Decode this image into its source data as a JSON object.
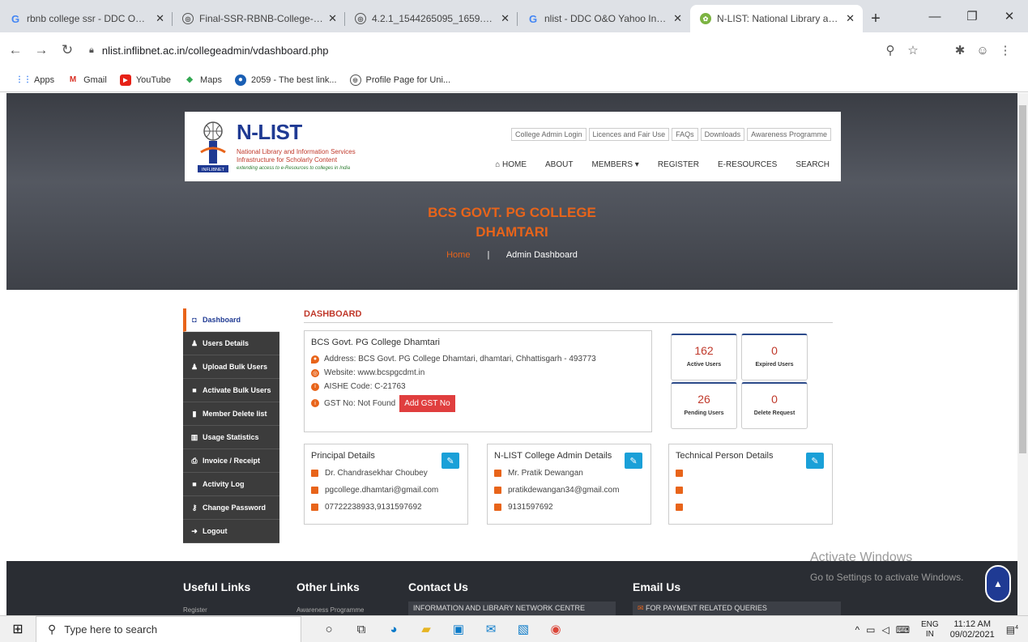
{
  "browser": {
    "tabs": [
      {
        "title": "rbnb college ssr - DDC O&O Y",
        "icon": "google-icon",
        "active": false
      },
      {
        "title": "Final-SSR-RBNB-College-after-",
        "icon": "globe-icon",
        "active": false
      },
      {
        "title": "4.2.1_1544265095_1659.pdf",
        "icon": "globe-icon",
        "active": false
      },
      {
        "title": "nlist - DDC O&O Yahoo India",
        "icon": "google-icon",
        "active": false
      },
      {
        "title": "N-LIST: National Library and In",
        "icon": "nlist-icon",
        "active": true
      }
    ],
    "url": "nlist.inflibnet.ac.in/collegeadmin/vdashboard.php",
    "bookmarks": [
      {
        "label": "Apps",
        "icon": "apps-grid-icon"
      },
      {
        "label": "Gmail",
        "icon": "gmail-icon"
      },
      {
        "label": "YouTube",
        "icon": "youtube-icon"
      },
      {
        "label": "Maps",
        "icon": "maps-icon"
      },
      {
        "label": "2059 - The best link...",
        "icon": "link-icon"
      },
      {
        "label": "Profile Page for Uni...",
        "icon": "globe-icon"
      }
    ]
  },
  "header": {
    "logo_title": "N-LIST",
    "logo_sub1": "National Library and Information Services",
    "logo_sub2": "Infrastructure for Scholarly Content",
    "logo_sub3": "extending access to e-Resources to colleges in India",
    "logo_badge": "INFLIBNET",
    "top_links": [
      "College Admin Login",
      "Licences and Fair Use",
      "FAQs",
      "Downloads",
      "Awareness Programme"
    ],
    "nav": [
      "HOME",
      "ABOUT",
      "MEMBERS ▾",
      "REGISTER",
      "E-RESOURCES",
      "SEARCH"
    ]
  },
  "hero": {
    "college_line1": "BCS GOVT. PG COLLEGE",
    "college_line2": "DHAMTARI",
    "crumb_home": "Home",
    "crumb_sep": "|",
    "crumb_current": "Admin Dashboard"
  },
  "sidebar": [
    {
      "label": "Dashboard",
      "icon": "dashboard-icon",
      "glyph": "◘"
    },
    {
      "label": "Users Details",
      "icon": "users-icon",
      "glyph": "♟"
    },
    {
      "label": "Upload Bulk Users",
      "icon": "users-upload-icon",
      "glyph": "♟"
    },
    {
      "label": "Activate Bulk Users",
      "icon": "check-square-icon",
      "glyph": "■"
    },
    {
      "label": "Member Delete list",
      "icon": "trash-icon",
      "glyph": "▮"
    },
    {
      "label": "Usage Statistics",
      "icon": "bar-chart-icon",
      "glyph": "▥"
    },
    {
      "label": "Invoice / Receipt",
      "icon": "print-icon",
      "glyph": "⎙"
    },
    {
      "label": "Activity Log",
      "icon": "list-icon",
      "glyph": "■"
    },
    {
      "label": "Change Password",
      "icon": "key-icon",
      "glyph": "⚷"
    },
    {
      "label": "Logout",
      "icon": "logout-icon",
      "glyph": "➜"
    }
  ],
  "dashboard": {
    "title": "DASHBOARD",
    "college_name": "BCS Govt. PG College Dhamtari",
    "address": "Address: BCS Govt. PG College Dhamtari, dhamtari, Chhattisgarh - 493773",
    "website": "Website: www.bcspgcdmt.in",
    "aishe": "AISHE Code: C-21763",
    "gst": "GST No: Not Found",
    "gst_button": "Add GST No",
    "stats": [
      {
        "value": "162",
        "label": "Active Users"
      },
      {
        "value": "0",
        "label": "Expired Users"
      },
      {
        "value": "26",
        "label": "Pending Users"
      },
      {
        "value": "0",
        "label": "Delete Request"
      }
    ],
    "principal": {
      "title": "Principal Details",
      "name": "Dr. Chandrasekhar Choubey",
      "email": "pgcollege.dhamtari@gmail.com",
      "phone": "07722238933,9131597692"
    },
    "admin": {
      "title": "N-LIST College Admin Details",
      "name": "Mr. Pratik Dewangan",
      "email": "pratikdewangan34@gmail.com",
      "phone": "9131597692"
    },
    "technical": {
      "title": "Technical Person Details",
      "name": "",
      "email": "",
      "phone": ""
    }
  },
  "footer": {
    "useful_links": "Useful Links",
    "useful_first": "Register",
    "other_links": "Other Links",
    "other_first": "Awareness Programme",
    "contact": "Contact Us",
    "contact_first": "INFORMATION AND LIBRARY NETWORK CENTRE",
    "email": "Email Us",
    "email_first": "FOR PAYMENT RELATED QUERIES"
  },
  "watermark": {
    "line1": "Activate Windows",
    "line2": "Go to Settings to activate Windows."
  },
  "taskbar": {
    "search_placeholder": "Type here to search",
    "lang_top": "ENG",
    "lang_bottom": "IN",
    "time": "11:12 AM",
    "date": "09/02/2021",
    "notifications": "4"
  },
  "colors": {
    "accent_orange": "#e8641a",
    "brand_blue": "#1f3a93",
    "gst_red": "#e03e3e",
    "edit_blue": "#1aa0d8"
  }
}
